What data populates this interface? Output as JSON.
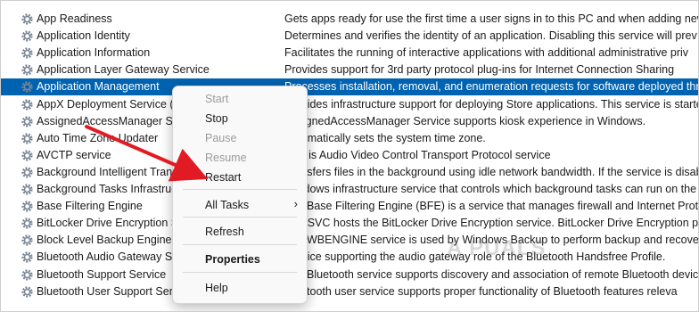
{
  "services": [
    {
      "name": "App Readiness",
      "desc": "Gets apps ready for use the first time a user signs in to this PC and when adding new"
    },
    {
      "name": "Application Identity",
      "desc": "Determines and verifies the identity of an application. Disabling this service will prev"
    },
    {
      "name": "Application Information",
      "desc": "Facilitates the running of interactive applications with additional administrative priv"
    },
    {
      "name": "Application Layer Gateway Service",
      "desc": "Provides support for 3rd party protocol plug-ins for Internet Connection Sharing"
    },
    {
      "name": "Application Management",
      "desc": "Processes installation, removal, and enumeration requests for software deployed thr"
    },
    {
      "name": "AppX Deployment Service (A",
      "desc": "Provides infrastructure support for deploying Store applications. This service is starte"
    },
    {
      "name": "AssignedAccessManager Ser",
      "desc": "AssignedAccessManager Service supports kiosk experience in Windows."
    },
    {
      "name": "Auto Time Zone Updater",
      "desc": "Automatically sets the system time zone."
    },
    {
      "name": "AVCTP service",
      "desc": "This is Audio Video Control Transport Protocol service"
    },
    {
      "name": "Background Intelligent Trans",
      "desc": "Transfers files in the background using idle network bandwidth. If the service is disab"
    },
    {
      "name": "Background Tasks Infrastruct",
      "desc": "Windows infrastructure service that controls which background tasks can run on the"
    },
    {
      "name": "Base Filtering Engine",
      "desc": "The Base Filtering Engine (BFE) is a service that manages firewall and Internet Protoc"
    },
    {
      "name": "BitLocker Drive Encryption Se",
      "desc": "BDESVC hosts the BitLocker Drive Encryption service. BitLocker Drive Encryption prov"
    },
    {
      "name": "Block Level Backup Engine Se",
      "desc": "The WBENGINE service is used by Windows Backup to perform backup and recovery"
    },
    {
      "name": "Bluetooth Audio Gateway Se",
      "desc": "Service supporting the audio gateway role of the Bluetooth Handsfree Profile."
    },
    {
      "name": "Bluetooth Support Service",
      "desc": "The Bluetooth service supports discovery and association of remote Bluetooth device"
    },
    {
      "name": "Bluetooth User Support Servi",
      "desc": "Bluetooth user service supports proper functionality of Bluetooth features releva"
    }
  ],
  "selected_index": 4,
  "context_menu": {
    "start": "Start",
    "stop": "Stop",
    "pause": "Pause",
    "resume": "Resume",
    "restart": "Restart",
    "all_tasks": "All Tasks",
    "all_tasks_arrow": "›",
    "refresh": "Refresh",
    "properties": "Properties",
    "help": "Help"
  },
  "watermark": "A PUALS",
  "colors": {
    "selection": "#0063b1",
    "arrow": "#e01b24",
    "gear": "#7a8797"
  }
}
